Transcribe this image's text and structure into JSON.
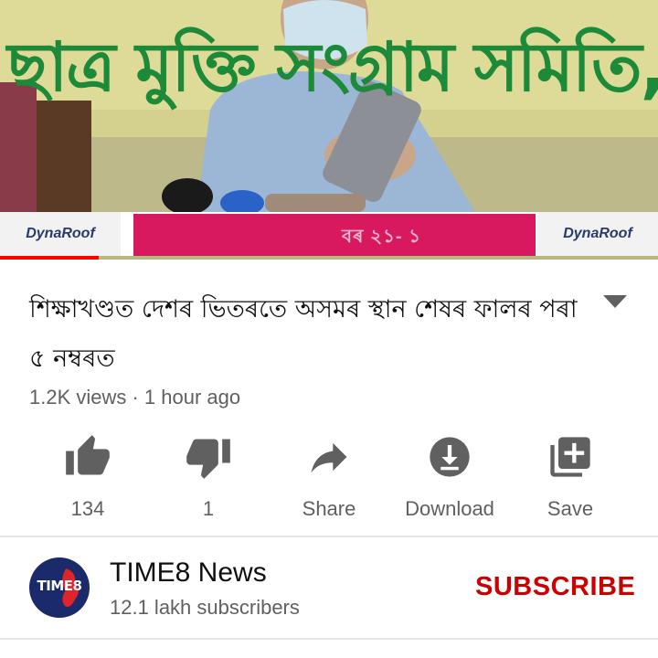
{
  "player": {
    "banner_text": "ছাত্ৰ মুক্তি সংগ্ৰাম সমিতি, অসম",
    "sponsor_left": "DynaRoof",
    "sponsor_right": "DynaRoof",
    "strip_text": "বৰ ২১- ১",
    "progress": 0.15,
    "progress_color": "#ff0000"
  },
  "video": {
    "title": "শিক্ষাখণ্ডত দেশৰ ভিতৰতে অসমৰ স্থান শেষৰ ফালৰ পৰা ৫ নম্বৰত",
    "meta": "1.2K views · 1 hour ago"
  },
  "actions": [
    {
      "label": "134",
      "icon": "thumbs-up-icon"
    },
    {
      "label": "1",
      "icon": "thumbs-down-icon"
    },
    {
      "label": "Share",
      "icon": "share-icon"
    },
    {
      "label": "Download",
      "icon": "download-icon"
    },
    {
      "label": "Save",
      "icon": "add-to-playlist-icon"
    }
  ],
  "channel": {
    "name": "TIME8 News",
    "subscribers": "12.1 lakh subscribers",
    "avatar_text": "TIME8",
    "subscribe_label": "SUBSCRIBE",
    "subscribe_color": "#cc0000"
  }
}
